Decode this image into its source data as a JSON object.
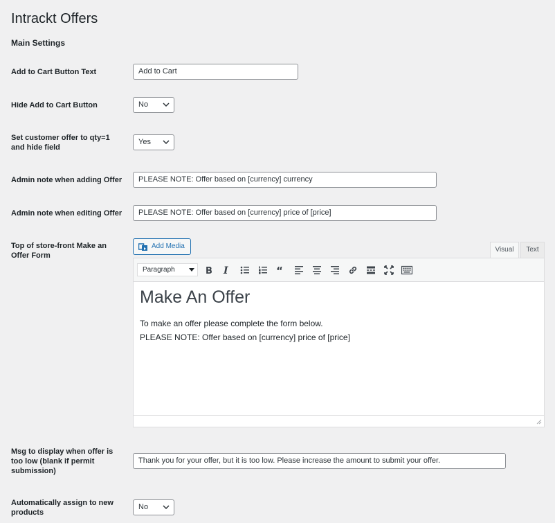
{
  "page": {
    "title": "Intrackt Offers",
    "section_title": "Main Settings"
  },
  "settings": {
    "add_to_cart_text": {
      "label": "Add to Cart Button Text",
      "value": "Add to Cart"
    },
    "hide_add_to_cart": {
      "label": "Hide Add to Cart Button",
      "value": "No"
    },
    "qty_one": {
      "label_line1": "Set customer offer to qty=1",
      "label_line2": "and hide field",
      "value": "Yes"
    },
    "admin_note_adding": {
      "label": "Admin note when adding Offer",
      "value": "PLEASE NOTE: Offer based on [currency] currency"
    },
    "admin_note_editing": {
      "label": "Admin note when editing Offer",
      "value": "PLEASE NOTE: Offer based on [currency] price of [price]"
    },
    "top_form": {
      "label_line1": "Top of store-front Make an",
      "label_line2": "Offer Form"
    },
    "msg_too_low": {
      "label_line1": "Msg to display when offer is",
      "label_line2": "too low (blank if permit",
      "label_line3": "submission)",
      "value": "Thank you for your offer, but it is too low. Please increase the amount to submit your offer."
    },
    "auto_assign": {
      "label_line1": "Automatically assign to new",
      "label_line2": "products",
      "value": "No"
    }
  },
  "editor": {
    "add_media_label": "Add Media",
    "tab_visual": "Visual",
    "tab_text": "Text",
    "format_value": "Paragraph",
    "toolbar_icons": [
      "bold-icon",
      "italic-icon",
      "bullet-list-icon",
      "numbered-list-icon",
      "blockquote-icon",
      "align-left-icon",
      "align-center-icon",
      "align-right-icon",
      "link-icon",
      "read-more-icon",
      "fullscreen-icon",
      "toolbar-toggle-icon"
    ],
    "heading": "Make An Offer",
    "line1": "To make an offer please complete the form below.",
    "line2": "PLEASE NOTE: Offer based on [currency] price of [price]"
  }
}
